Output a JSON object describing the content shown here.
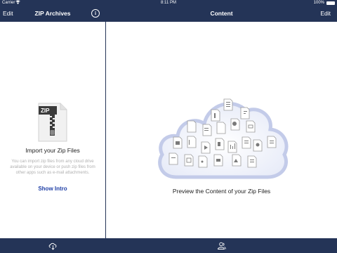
{
  "status_bar": {
    "carrier": "Carrier",
    "time": "8:11 PM",
    "battery": "100%"
  },
  "left_panel": {
    "edit_label": "Edit",
    "title": "ZIP Archives",
    "info_label": "i",
    "zip_icon_label": "ZIP",
    "import_title": "Import your Zip Files",
    "import_description": "You can import zip files from any cloud drive available on your device or push zip files from other apps such as e-mail attachments.",
    "show_intro_label": "Show Intro"
  },
  "right_panel": {
    "title": "Content",
    "edit_label": "Edit",
    "preview_text": "Preview the Content of your Zip Files"
  },
  "bottom_bar": {
    "left_icon": "cloud-download-icon",
    "right_icon": "contacts-icon"
  },
  "colors": {
    "bar": "#243457",
    "accent_link": "#1f3fa6",
    "cloud_border": "#b9c2e2",
    "cloud_fill": "#eef1fb"
  }
}
